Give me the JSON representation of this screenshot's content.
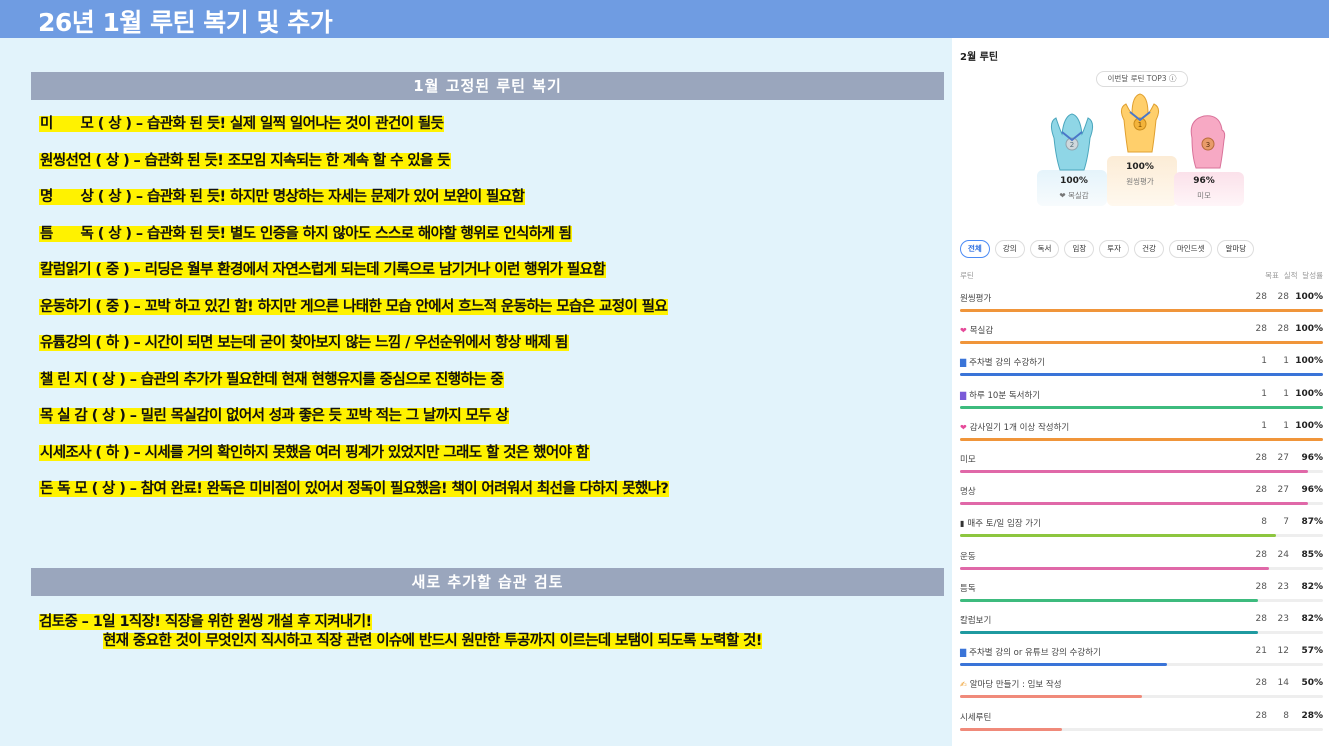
{
  "page": {
    "title": "26년 1월 루틴 복기 및 추가"
  },
  "section1": {
    "heading": "1월 고정된 루틴 복기",
    "items": [
      "미　　모 ( 상 ) – 습관화 된 듯! 실제 일찍 일어나는 것이 관건이 될듯",
      "원씽선언 ( 상 ) – 습관화 된 듯! 조모임 지속되는 한 계속 할 수 있을 듯",
      "명　　상 ( 상 ) – 습관화 된 듯! 하지만 명상하는 자세는 문제가 있어 보완이 필요함",
      "틈　　독 ( 상 ) – 습관화 된 듯! 별도 인증을 하지 않아도 스스로 해야할 행위로 인식하게 됨",
      "칼럼읽기 ( 중 ) – 리딩은 월부 환경에서 자연스럽게 되는데 기록으로 남기거나 이런 행위가 필요함",
      "운동하기 ( 중 ) – 꼬박 하고 있긴 함! 하지만 게으른 나태한 모습 안에서 흐느적 운동하는 모습은 교정이 필요",
      "유튭강의 ( 하 ) – 시간이 되면 보는데 굳이 찾아보지 않는 느낌 / 우선순위에서 항상 배제 됨",
      "챌 린 지 ( 상 ) – 습관의 추가가 필요한데 현재 현행유지를 중심으로 진행하는 중",
      "목 실 감 ( 상 ) – 밀린 목실감이 없어서 성과 좋은 듯 꼬박 적는 그 날까지 모두 상",
      "시세조사 ( 하 ) – 시세를 거의 확인하지 못했음 여러 핑계가 있었지만 그래도 할 것은 했어야 함",
      "돈 독 모 ( 상 ) – 참여 완료! 완독은 미비점이 있어서 정독이 필요했음! 책이 어려워서 최선을 다하지 못했나?"
    ]
  },
  "section2": {
    "heading": "새로 추가할 습관 검토",
    "line1": "검토중 – 1일 1직장! 직장을 위한 원씽 개설 후 지켜내기!",
    "line2": "현재 중요한 것이 무엇인지 직시하고 직장 관련 이슈에 반드시 원만한 투공까지 이르는데 보탬이 되도록 노력할 것!"
  },
  "panel": {
    "title": "2월 루틴",
    "top3_label": "이번달 루틴 TOP3 ⓘ",
    "top3": [
      {
        "rank": "2",
        "pct": "100%",
        "name": "목실감",
        "color": "#8fd6e6"
      },
      {
        "rank": "1",
        "pct": "100%",
        "name": "원씽평가",
        "color": "#ffcf6b"
      },
      {
        "rank": "3",
        "pct": "96%",
        "name": "미모",
        "color": "#f7a9c4"
      }
    ],
    "tabs": [
      "전체",
      "강의",
      "독서",
      "임장",
      "투자",
      "건강",
      "마인드셋",
      "알마당"
    ],
    "list_header": {
      "col_name": "루틴",
      "col_goal": "목표",
      "col_actual": "실적",
      "col_rate": "달성률"
    },
    "rows": [
      {
        "name": "원씽평가",
        "goal": "28",
        "actual": "28",
        "rate": "100%",
        "fill": 1.0,
        "color": "#f0953a",
        "icon": ""
      },
      {
        "name": "목실감",
        "goal": "28",
        "actual": "28",
        "rate": "100%",
        "fill": 1.0,
        "color": "#f0953a",
        "icon": "heart"
      },
      {
        "name": "주차별 강의 수강하기",
        "goal": "1",
        "actual": "1",
        "rate": "100%",
        "fill": 1.0,
        "color": "#3a74d8",
        "icon": "book"
      },
      {
        "name": "하루 10분 독서하기",
        "goal": "1",
        "actual": "1",
        "rate": "100%",
        "fill": 1.0,
        "color": "#3dbb7e",
        "icon": "books"
      },
      {
        "name": "감사일기 1개 이상 작성하기",
        "goal": "1",
        "actual": "1",
        "rate": "100%",
        "fill": 1.0,
        "color": "#f0953a",
        "icon": "heart"
      },
      {
        "name": "미모",
        "goal": "28",
        "actual": "27",
        "rate": "96%",
        "fill": 0.96,
        "color": "#e068a8",
        "icon": ""
      },
      {
        "name": "명상",
        "goal": "28",
        "actual": "27",
        "rate": "96%",
        "fill": 0.96,
        "color": "#e068a8",
        "icon": ""
      },
      {
        "name": "매주 토/일 임장 가기",
        "goal": "8",
        "actual": "7",
        "rate": "87%",
        "fill": 0.87,
        "color": "#8dc63f",
        "icon": "feet"
      },
      {
        "name": "운동",
        "goal": "28",
        "actual": "24",
        "rate": "85%",
        "fill": 0.85,
        "color": "#e068a8",
        "icon": ""
      },
      {
        "name": "틈독",
        "goal": "28",
        "actual": "23",
        "rate": "82%",
        "fill": 0.82,
        "color": "#3dbb7e",
        "icon": ""
      },
      {
        "name": "칼럼보기",
        "goal": "28",
        "actual": "23",
        "rate": "82%",
        "fill": 0.82,
        "color": "#1f9aa0",
        "icon": ""
      },
      {
        "name": "주차별 강의 or 유튜브 강의 수강하기",
        "goal": "21",
        "actual": "12",
        "rate": "57%",
        "fill": 0.57,
        "color": "#3a74d8",
        "icon": "book"
      },
      {
        "name": "알마당 만들기 : 임보 작성",
        "goal": "28",
        "actual": "14",
        "rate": "50%",
        "fill": 0.5,
        "color": "#f08a7a",
        "icon": "pen"
      },
      {
        "name": "시세루틴",
        "goal": "28",
        "actual": "8",
        "rate": "28%",
        "fill": 0.28,
        "color": "#f08a7a",
        "icon": ""
      }
    ]
  }
}
